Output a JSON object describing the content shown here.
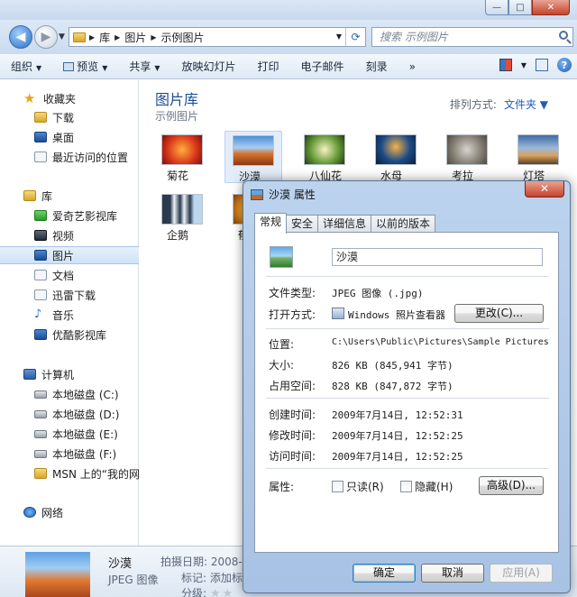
{
  "window": {
    "minimize": "—",
    "maximize": "□",
    "close": "✕"
  },
  "navigation": {
    "back": "◀",
    "forward": "▶",
    "breadcrumb": [
      "库",
      "图片",
      "示例图片"
    ],
    "search_placeholder": "搜索 示例图片"
  },
  "toolbar": {
    "items": [
      "组织",
      "预览",
      "共享",
      "放映幻灯片",
      "打印",
      "电子邮件",
      "刻录"
    ],
    "more": "»",
    "help": "?"
  },
  "sidebar": {
    "favorites_header": "收藏夹",
    "favorites": [
      "下载",
      "桌面",
      "最近访问的位置"
    ],
    "libraries_header": "库",
    "libraries": [
      "爱奇艺影视库",
      "视频",
      "图片",
      "文档",
      "迅雷下载",
      "音乐",
      "优酷影视库"
    ],
    "computer_header": "计算机",
    "drives": [
      "本地磁盘 (C:)",
      "本地磁盘 (D:)",
      "本地磁盘 (E:)",
      "本地磁盘 (F:)",
      "MSN 上的“我的网"
    ],
    "network": "网络"
  },
  "content": {
    "title": "图片库",
    "subtitle": "示例图片",
    "sort_label": "排列方式:",
    "sort_value": "文件夹",
    "thumbnails": [
      "菊花",
      "沙漠",
      "八仙花",
      "水母",
      "考拉",
      "灯塔",
      "企鹅",
      "郁"
    ]
  },
  "details": {
    "name": "沙漠",
    "type": "JPEG 图像",
    "date_label": "拍摄日期: 2008-3",
    "tags_label": "标记: 添加标",
    "rating_label": "分级:"
  },
  "dialog": {
    "title": "沙漠 属性",
    "tabs": [
      "常规",
      "安全",
      "详细信息",
      "以前的版本"
    ],
    "filename": "沙漠",
    "rows": [
      {
        "label": "文件类型:",
        "value": "JPEG 图像 (.jpg)"
      },
      {
        "label": "打开方式:",
        "value": "Windows 照片查看器"
      },
      {
        "label": "位置:",
        "value": "C:\\Users\\Public\\Pictures\\Sample Pictures"
      },
      {
        "label": "大小:",
        "value": "826 KB (845,941 字节)"
      },
      {
        "label": "占用空间:",
        "value": "828 KB (847,872 字节)"
      },
      {
        "label": "创建时间:",
        "value": "2009年7月14日, 12:52:31"
      },
      {
        "label": "修改时间:",
        "value": "2009年7月14日, 12:52:25"
      },
      {
        "label": "访问时间:",
        "value": "2009年7月14日, 12:52:25"
      }
    ],
    "change_button": "更改(C)...",
    "attributes_label": "属性:",
    "readonly": "只读(R)",
    "hidden": "隐藏(H)",
    "advanced_button": "高级(D)...",
    "ok": "确定",
    "cancel": "取消",
    "apply": "应用(A)"
  }
}
